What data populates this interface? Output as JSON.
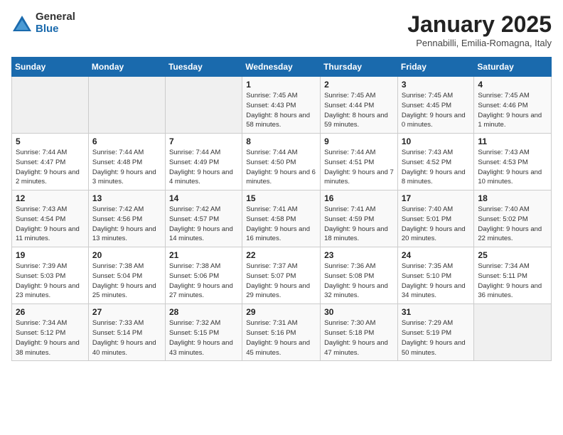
{
  "header": {
    "logo_general": "General",
    "logo_blue": "Blue",
    "title": "January 2025",
    "subtitle": "Pennabilli, Emilia-Romagna, Italy"
  },
  "weekdays": [
    "Sunday",
    "Monday",
    "Tuesday",
    "Wednesday",
    "Thursday",
    "Friday",
    "Saturday"
  ],
  "weeks": [
    [
      {
        "day": "",
        "info": ""
      },
      {
        "day": "",
        "info": ""
      },
      {
        "day": "",
        "info": ""
      },
      {
        "day": "1",
        "info": "Sunrise: 7:45 AM\nSunset: 4:43 PM\nDaylight: 8 hours and 58 minutes."
      },
      {
        "day": "2",
        "info": "Sunrise: 7:45 AM\nSunset: 4:44 PM\nDaylight: 8 hours and 59 minutes."
      },
      {
        "day": "3",
        "info": "Sunrise: 7:45 AM\nSunset: 4:45 PM\nDaylight: 9 hours and 0 minutes."
      },
      {
        "day": "4",
        "info": "Sunrise: 7:45 AM\nSunset: 4:46 PM\nDaylight: 9 hours and 1 minute."
      }
    ],
    [
      {
        "day": "5",
        "info": "Sunrise: 7:44 AM\nSunset: 4:47 PM\nDaylight: 9 hours and 2 minutes."
      },
      {
        "day": "6",
        "info": "Sunrise: 7:44 AM\nSunset: 4:48 PM\nDaylight: 9 hours and 3 minutes."
      },
      {
        "day": "7",
        "info": "Sunrise: 7:44 AM\nSunset: 4:49 PM\nDaylight: 9 hours and 4 minutes."
      },
      {
        "day": "8",
        "info": "Sunrise: 7:44 AM\nSunset: 4:50 PM\nDaylight: 9 hours and 6 minutes."
      },
      {
        "day": "9",
        "info": "Sunrise: 7:44 AM\nSunset: 4:51 PM\nDaylight: 9 hours and 7 minutes."
      },
      {
        "day": "10",
        "info": "Sunrise: 7:43 AM\nSunset: 4:52 PM\nDaylight: 9 hours and 8 minutes."
      },
      {
        "day": "11",
        "info": "Sunrise: 7:43 AM\nSunset: 4:53 PM\nDaylight: 9 hours and 10 minutes."
      }
    ],
    [
      {
        "day": "12",
        "info": "Sunrise: 7:43 AM\nSunset: 4:54 PM\nDaylight: 9 hours and 11 minutes."
      },
      {
        "day": "13",
        "info": "Sunrise: 7:42 AM\nSunset: 4:56 PM\nDaylight: 9 hours and 13 minutes."
      },
      {
        "day": "14",
        "info": "Sunrise: 7:42 AM\nSunset: 4:57 PM\nDaylight: 9 hours and 14 minutes."
      },
      {
        "day": "15",
        "info": "Sunrise: 7:41 AM\nSunset: 4:58 PM\nDaylight: 9 hours and 16 minutes."
      },
      {
        "day": "16",
        "info": "Sunrise: 7:41 AM\nSunset: 4:59 PM\nDaylight: 9 hours and 18 minutes."
      },
      {
        "day": "17",
        "info": "Sunrise: 7:40 AM\nSunset: 5:01 PM\nDaylight: 9 hours and 20 minutes."
      },
      {
        "day": "18",
        "info": "Sunrise: 7:40 AM\nSunset: 5:02 PM\nDaylight: 9 hours and 22 minutes."
      }
    ],
    [
      {
        "day": "19",
        "info": "Sunrise: 7:39 AM\nSunset: 5:03 PM\nDaylight: 9 hours and 23 minutes."
      },
      {
        "day": "20",
        "info": "Sunrise: 7:38 AM\nSunset: 5:04 PM\nDaylight: 9 hours and 25 minutes."
      },
      {
        "day": "21",
        "info": "Sunrise: 7:38 AM\nSunset: 5:06 PM\nDaylight: 9 hours and 27 minutes."
      },
      {
        "day": "22",
        "info": "Sunrise: 7:37 AM\nSunset: 5:07 PM\nDaylight: 9 hours and 29 minutes."
      },
      {
        "day": "23",
        "info": "Sunrise: 7:36 AM\nSunset: 5:08 PM\nDaylight: 9 hours and 32 minutes."
      },
      {
        "day": "24",
        "info": "Sunrise: 7:35 AM\nSunset: 5:10 PM\nDaylight: 9 hours and 34 minutes."
      },
      {
        "day": "25",
        "info": "Sunrise: 7:34 AM\nSunset: 5:11 PM\nDaylight: 9 hours and 36 minutes."
      }
    ],
    [
      {
        "day": "26",
        "info": "Sunrise: 7:34 AM\nSunset: 5:12 PM\nDaylight: 9 hours and 38 minutes."
      },
      {
        "day": "27",
        "info": "Sunrise: 7:33 AM\nSunset: 5:14 PM\nDaylight: 9 hours and 40 minutes."
      },
      {
        "day": "28",
        "info": "Sunrise: 7:32 AM\nSunset: 5:15 PM\nDaylight: 9 hours and 43 minutes."
      },
      {
        "day": "29",
        "info": "Sunrise: 7:31 AM\nSunset: 5:16 PM\nDaylight: 9 hours and 45 minutes."
      },
      {
        "day": "30",
        "info": "Sunrise: 7:30 AM\nSunset: 5:18 PM\nDaylight: 9 hours and 47 minutes."
      },
      {
        "day": "31",
        "info": "Sunrise: 7:29 AM\nSunset: 5:19 PM\nDaylight: 9 hours and 50 minutes."
      },
      {
        "day": "",
        "info": ""
      }
    ]
  ]
}
